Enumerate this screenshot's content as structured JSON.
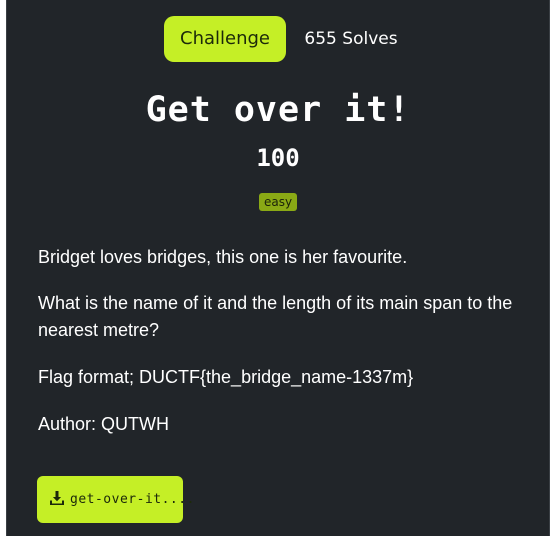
{
  "tabs": {
    "challenge_label": "Challenge",
    "solves_label": "655 Solves"
  },
  "challenge": {
    "title": "Get over it!",
    "points": "100",
    "difficulty": "easy",
    "description": [
      "Bridget loves bridges, this one is her favourite.",
      "What is the name of it and the length of its main span to the nearest metre?",
      "Flag format; DUCTF{the_bridge_name-1337m}",
      "Author: QUTWH"
    ]
  },
  "files": {
    "download_label": "get-over-it....",
    "icon": "download-icon"
  },
  "colors": {
    "background": "#212529",
    "accent": "#c5ef26",
    "badge": "#8aa915"
  }
}
